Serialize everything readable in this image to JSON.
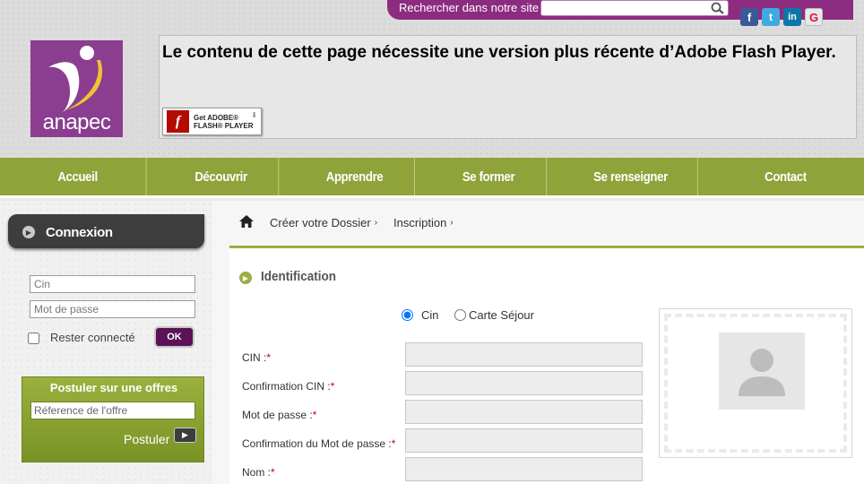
{
  "header": {
    "search_label": "Rechercher dans notre site",
    "search_placeholder": "",
    "logo_text": "anapec",
    "flash_message": "Le contenu de cette page nécessite une version plus récente d’Adobe Flash Player.",
    "flash_badge_line1": "Get ADOBE®",
    "flash_badge_line2": "FLASH® PLAYER",
    "social": [
      {
        "name": "facebook",
        "glyph": "f"
      },
      {
        "name": "twitter",
        "glyph": "t"
      },
      {
        "name": "linkedin",
        "glyph": "in"
      },
      {
        "name": "google-plus",
        "glyph": "G"
      }
    ]
  },
  "nav": {
    "items": [
      "Accueil",
      "Découvrir",
      "Apprendre",
      "Se former",
      "Se renseigner",
      "Contact"
    ]
  },
  "sidebar": {
    "login_title": "Connexion",
    "cin_placeholder": "Cin",
    "password_placeholder": "Mot de passe",
    "remember_label": "Rester connecté",
    "ok_label": "OK",
    "offer_title": "Postuler sur une offres",
    "offer_placeholder": "Réference de l'offre",
    "postuler_label": "Postuler"
  },
  "breadcrumb": {
    "items": [
      "Créer votre Dossier",
      "Inscription"
    ],
    "separator": "›"
  },
  "form": {
    "section_title": "Identification",
    "radio_cin": "Cin",
    "radio_carte": "Carte Séjour",
    "radio_selected": "Cin",
    "required_mark": "*",
    "fields": [
      {
        "label": "CIN :"
      },
      {
        "label": "Confirmation CIN :"
      },
      {
        "label": "Mot de passe :"
      },
      {
        "label": "Confirmation du Mot de passe :"
      },
      {
        "label": "Nom :"
      }
    ]
  },
  "colors": {
    "brand_purple": "#8c2c80",
    "nav_green": "#8fa33a",
    "dark_tab": "#3d3d3d",
    "required_red": "#cc0000"
  }
}
